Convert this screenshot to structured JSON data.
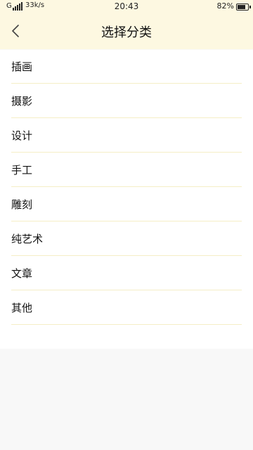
{
  "status_bar": {
    "network": "G",
    "speed": "33k/s",
    "time": "20:43",
    "battery": "82%",
    "battery_level": 0.82
  },
  "header": {
    "title": "选择分类",
    "back_icon": "chevron-left-icon"
  },
  "categories": [
    {
      "label": "插画"
    },
    {
      "label": "摄影"
    },
    {
      "label": "设计"
    },
    {
      "label": "手工"
    },
    {
      "label": "雕刻"
    },
    {
      "label": "纯艺术"
    },
    {
      "label": "文章"
    },
    {
      "label": "其他"
    }
  ],
  "colors": {
    "header_bg": "#fdf8e1",
    "divider": "#f5eec6",
    "page_bg": "#f8f8f8"
  }
}
